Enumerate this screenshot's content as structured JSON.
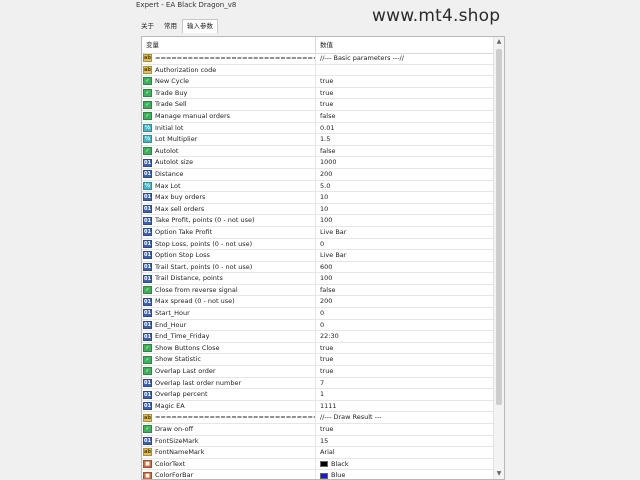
{
  "window": {
    "title": "Expert - EA Black Dragon_v8"
  },
  "watermark": "www.mt4.shop",
  "tabs": [
    {
      "label": "关于",
      "active": false
    },
    {
      "label": "常用",
      "active": false
    },
    {
      "label": "输入参数",
      "active": true
    }
  ],
  "table": {
    "headers": {
      "variable": "变量",
      "value": "数值"
    },
    "rows": [
      {
        "icon": "text-icon",
        "name": "================================================",
        "value": "//--- Basic parameters ---//"
      },
      {
        "icon": "text-icon",
        "name": "Authorization code",
        "value": ""
      },
      {
        "icon": "bool-icon",
        "name": "New Cycle",
        "value": "true"
      },
      {
        "icon": "bool-icon",
        "name": "Trade Buy",
        "value": "true"
      },
      {
        "icon": "bool-icon",
        "name": "Trade Sell",
        "value": "true"
      },
      {
        "icon": "bool-icon",
        "name": "Manage manual orders",
        "value": "false"
      },
      {
        "icon": "double-icon",
        "name": "Initial lot",
        "value": "0.01"
      },
      {
        "icon": "double-icon",
        "name": "Lot Multiplier",
        "value": "1.5"
      },
      {
        "icon": "bool-icon",
        "name": "Autolot",
        "value": "false"
      },
      {
        "icon": "integer-icon",
        "name": "Autolot size",
        "value": "1000"
      },
      {
        "icon": "integer-icon",
        "name": "Distance",
        "value": "200"
      },
      {
        "icon": "double-icon",
        "name": "Max Lot",
        "value": "5.0"
      },
      {
        "icon": "integer-icon",
        "name": "Max buy orders",
        "value": "10"
      },
      {
        "icon": "integer-icon",
        "name": "Max sell orders",
        "value": "10"
      },
      {
        "icon": "integer-icon",
        "name": "Take Profit, points (0 - not use)",
        "value": "100"
      },
      {
        "icon": "integer-icon",
        "name": "Option Take Profit",
        "value": "Live Bar"
      },
      {
        "icon": "integer-icon",
        "name": "Stop Loss, points (0 - not use)",
        "value": "0"
      },
      {
        "icon": "integer-icon",
        "name": "Option Stop Loss",
        "value": "Live Bar"
      },
      {
        "icon": "integer-icon",
        "name": "Trail Start, points (0 - not use)",
        "value": "600"
      },
      {
        "icon": "integer-icon",
        "name": "Trail Distance, points",
        "value": "100"
      },
      {
        "icon": "bool-icon",
        "name": "Close from reverse signal",
        "value": "false"
      },
      {
        "icon": "integer-icon",
        "name": "Max spread (0 - not use)",
        "value": "200"
      },
      {
        "icon": "integer-icon",
        "name": "Start_Hour",
        "value": "0"
      },
      {
        "icon": "integer-icon",
        "name": "End_Hour",
        "value": "0"
      },
      {
        "icon": "integer-icon",
        "name": "End_Time_Friday",
        "value": "22:30"
      },
      {
        "icon": "bool-icon",
        "name": "Show Buttons Close",
        "value": "true"
      },
      {
        "icon": "bool-icon",
        "name": "Show Statistic",
        "value": "true"
      },
      {
        "icon": "bool-icon",
        "name": "Overlap Last order",
        "value": "true"
      },
      {
        "icon": "integer-icon",
        "name": "Overlap last order number",
        "value": "7"
      },
      {
        "icon": "integer-icon",
        "name": "Overlap percent",
        "value": "1"
      },
      {
        "icon": "integer-icon",
        "name": "Magic EA",
        "value": "1111"
      },
      {
        "icon": "text-icon",
        "name": "================================================",
        "value": "//--- Draw Result ---"
      },
      {
        "icon": "bool-icon",
        "name": "Draw on-off",
        "value": "true"
      },
      {
        "icon": "integer-icon",
        "name": "FontSizeMark",
        "value": "15"
      },
      {
        "icon": "text-icon",
        "name": "FontNameMark",
        "value": "Arial"
      },
      {
        "icon": "color-icon",
        "name": "ColorText",
        "value": "Black",
        "swatch": "#000000"
      },
      {
        "icon": "color-icon",
        "name": "ColorForBar",
        "value": "Blue",
        "swatch": "#1a1acc"
      }
    ]
  }
}
